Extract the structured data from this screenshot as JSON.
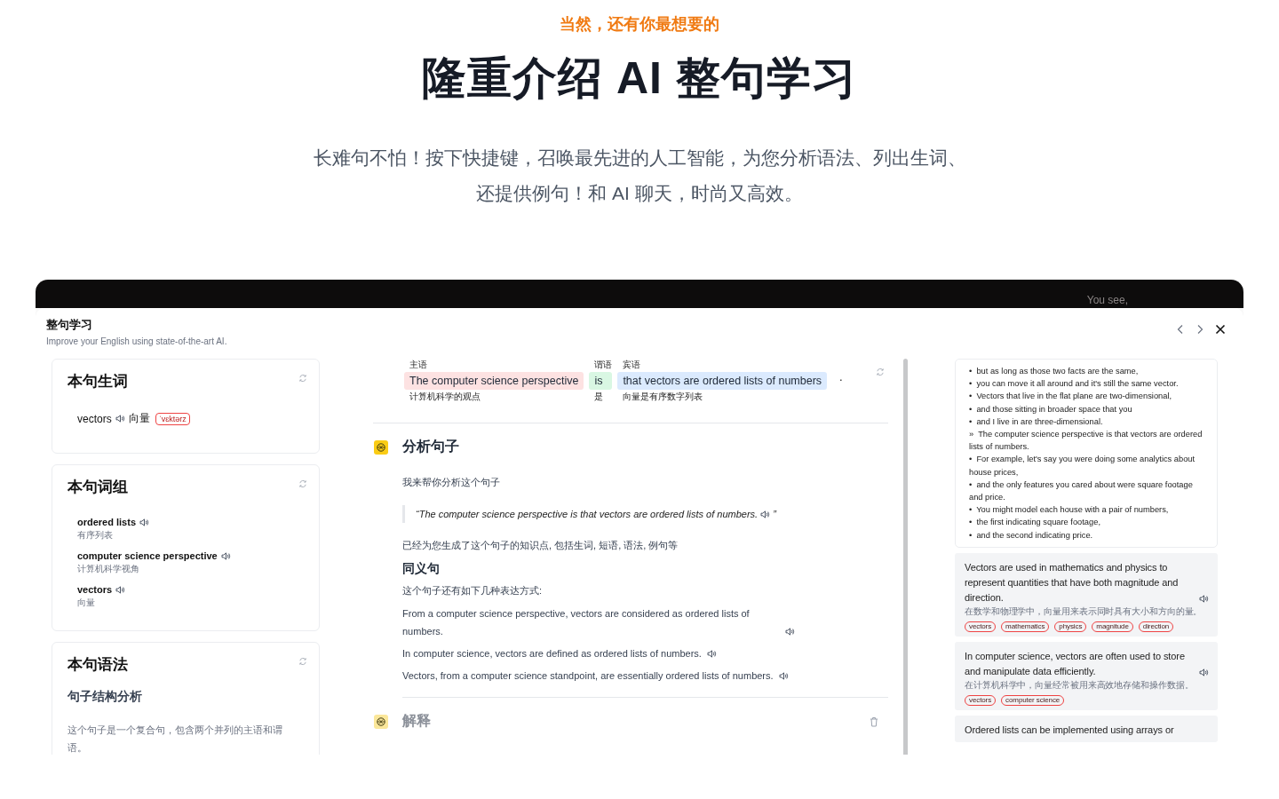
{
  "kicker": "当然，还有你最想要的",
  "headline": "隆重介绍 AI 整句学习",
  "intro": [
    "长难句不怕！按下快捷键，召唤最先进的人工智能，为您分析语法、列出生词、",
    "还提供例句！和 AI 聊天，时尚又高效。"
  ],
  "app": {
    "backdrop_caption": "You see,",
    "title": "整句学习",
    "subtitle": "Improve your English using state-of-the-art AI.",
    "words_card": {
      "title": "本句生词",
      "items": [
        {
          "word": "vectors",
          "meaning": "向量",
          "phonetic": "ˈvɛktərz"
        }
      ]
    },
    "phrases_card": {
      "title": "本句词组",
      "items": [
        {
          "phrase": "ordered lists",
          "meaning": "有序列表"
        },
        {
          "phrase": "computer science perspective",
          "meaning": "计算机科学视角"
        },
        {
          "phrase": "vectors",
          "meaning": "向量"
        }
      ]
    },
    "grammar_card": {
      "title": "本句语法",
      "heading": "句子结构分析",
      "text": "这个句子是一个复合句，包含两个并列的主语和谓语。"
    },
    "sentence": {
      "chunks": [
        {
          "role": "主语",
          "text": "The computer science perspective",
          "gloss": "计算机科学的观点",
          "color": "#fde2e2"
        },
        {
          "role": "谓语",
          "text": "is",
          "gloss": "是",
          "color": "#d9f7e3"
        },
        {
          "role": "宾语",
          "text": "that vectors are ordered lists of numbers",
          "gloss": "向量是有序数字列表",
          "color": "#dbeafe"
        }
      ],
      "end_mark": "."
    },
    "analysis": {
      "title": "分析句子",
      "intro": "我来帮你分析这个句子",
      "quote": "“The computer science perspective is that vectors are ordered lists of numbers.",
      "quote_end": "”",
      "summary": "已经为您生成了这个句子的知识点, 包括生词, 短语, 语法, 例句等",
      "synonyms_title": "同义句",
      "synonyms_intro": "这个句子还有如下几种表达方式:",
      "synonyms": [
        "From a computer science perspective, vectors are considered as ordered lists of numbers.",
        "In computer science, vectors are defined as ordered lists of numbers.",
        "Vectors, from a computer science standpoint, are essentially ordered lists of numbers."
      ]
    },
    "explain": {
      "title": "解释"
    },
    "transcript": [
      {
        "marker": "•",
        "text": "but as long as those two facts are the same,"
      },
      {
        "marker": "•",
        "text": "you can move it all around and it's still the same vector."
      },
      {
        "marker": "•",
        "text": "Vectors that live in the flat plane are two-dimensional,"
      },
      {
        "marker": "•",
        "text": "and those sitting in broader space that you"
      },
      {
        "marker": "•",
        "text": "and I live in are three-dimensional."
      },
      {
        "marker": "»",
        "text": "The computer science perspective is that vectors are ordered lists of numbers."
      },
      {
        "marker": "•",
        "text": "For example, let's say you were doing some analytics about house prices,"
      },
      {
        "marker": "•",
        "text": "and the only features you cared about were square footage and price."
      },
      {
        "marker": "•",
        "text": "You might model each house with a pair of numbers,"
      },
      {
        "marker": "•",
        "text": "the first indicating square footage,"
      },
      {
        "marker": "•",
        "text": "and the second indicating price."
      }
    ],
    "examples": [
      {
        "text": "Vectors are used in mathematics and physics to represent quantities that have both magnitude and direction.",
        "translation": "在数学和物理学中，向量用来表示同时具有大小和方向的量。",
        "tags": [
          "vectors",
          "mathematics",
          "physics",
          "magnitude",
          "direction"
        ]
      },
      {
        "text": "In computer science, vectors are often used to store and manipulate data efficiently.",
        "translation": "在计算机科学中，向量经常被用来高效地存储和操作数据。",
        "tags": [
          "vectors",
          "computer science"
        ]
      },
      {
        "text": "Ordered lists can be implemented using arrays or"
      }
    ]
  }
}
